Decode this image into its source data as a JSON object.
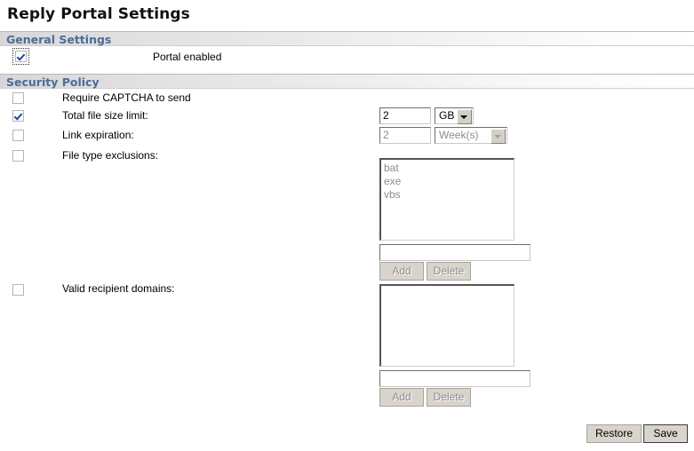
{
  "page": {
    "title": "Reply Portal Settings"
  },
  "sections": {
    "general": {
      "header": "General Settings",
      "portal_enabled_label": "Portal enabled",
      "portal_enabled_checked": true
    },
    "security": {
      "header": "Security Policy",
      "captcha_label": "Require CAPTCHA to send",
      "file_size_label": "Total file size limit:",
      "file_size_value": "2",
      "file_size_unit": "GB",
      "link_expiration_label": "Link expiration:",
      "link_expiration_value": "2",
      "link_expiration_unit": "Week(s)",
      "file_type_label": "File type exclusions:",
      "file_type_items": [
        "bat",
        "exe",
        "vbs"
      ],
      "file_type_input_value": "",
      "valid_domains_label": "Valid recipient domains:",
      "valid_domains_items": [],
      "valid_domains_input_value": "",
      "add_label": "Add",
      "delete_label": "Delete"
    }
  },
  "footer": {
    "restore_label": "Restore",
    "save_label": "Save"
  },
  "colors": {
    "section_header_text": "#4a6c9b",
    "checkbox_check": "#1b48a8",
    "disabled_text": "#8d8d8d",
    "button_face": "#d8d4cb"
  }
}
